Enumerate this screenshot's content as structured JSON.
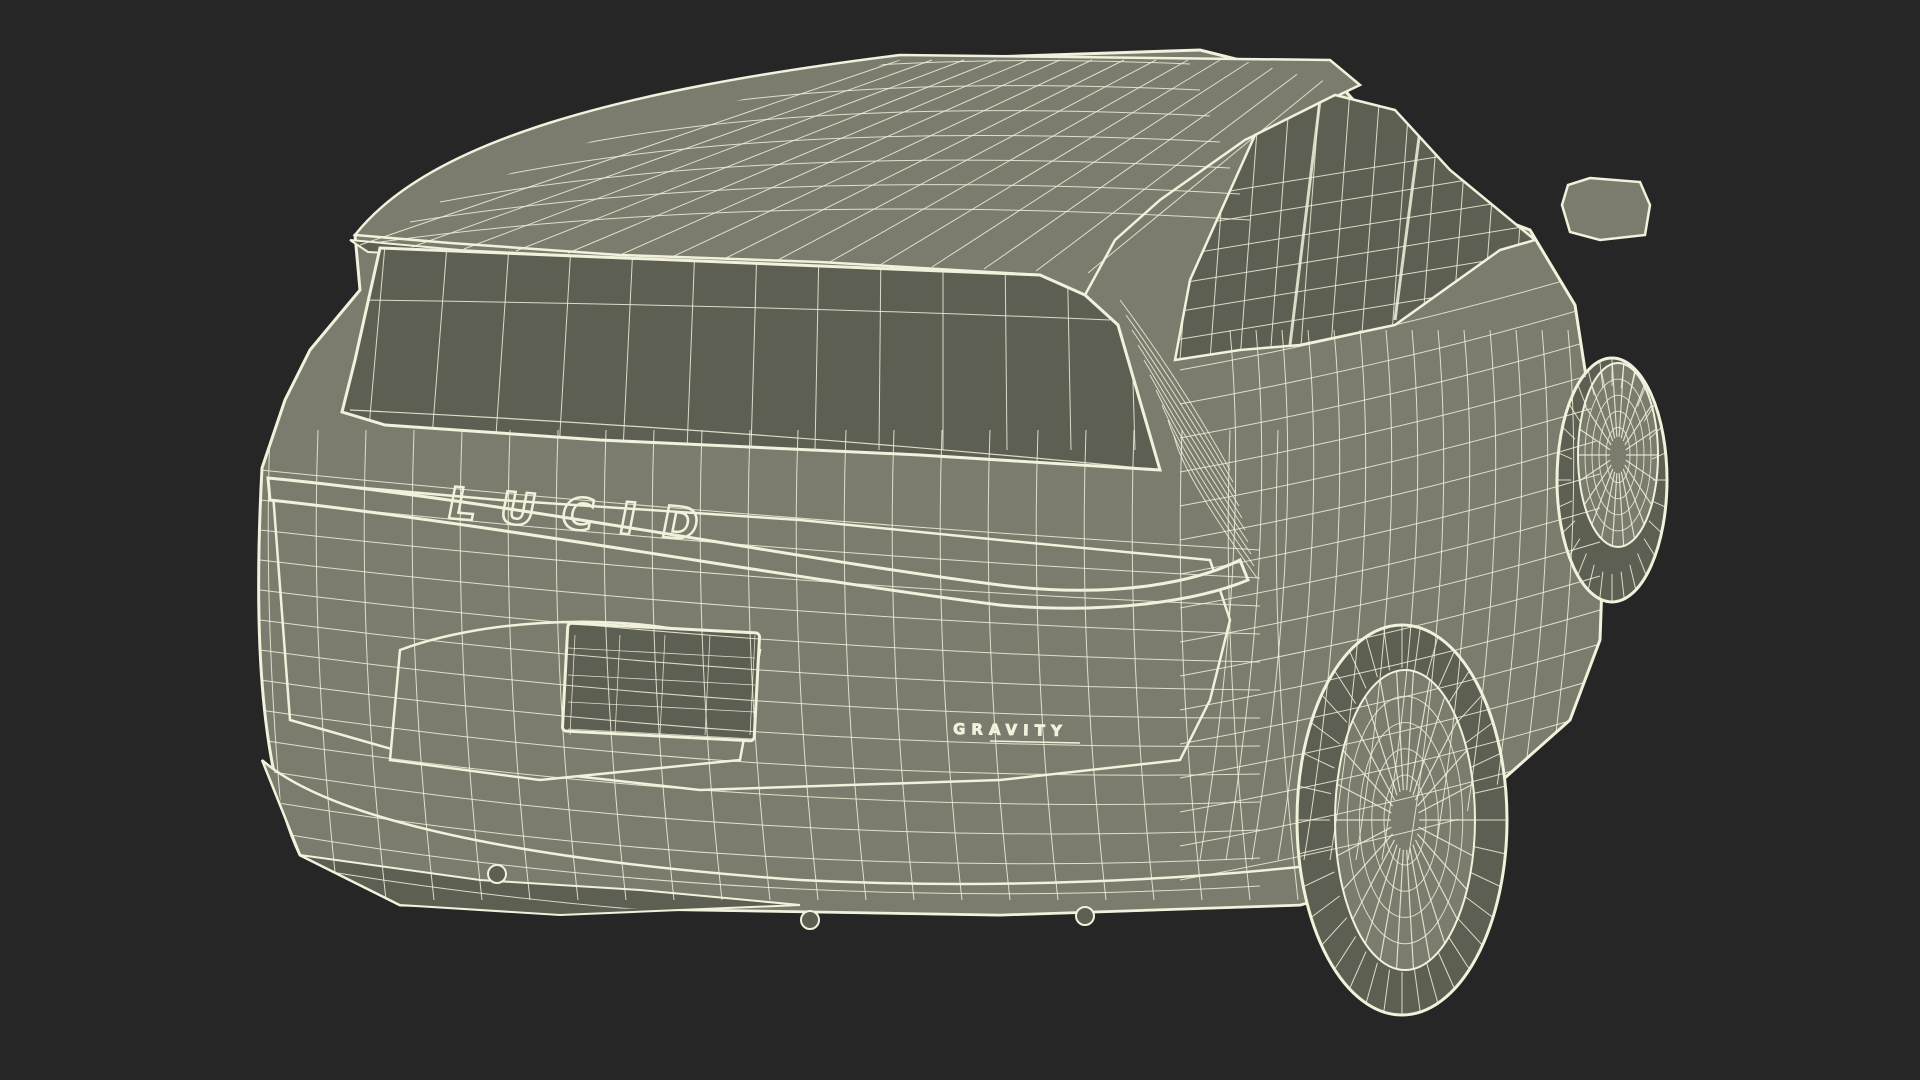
{
  "scene": {
    "background_color": "#262626",
    "surface_color": "#7b7c6d",
    "surface_dark_color": "#5e5f53",
    "wire_color": "#f1f1dc",
    "subject": "wireframe-suv-rear-three-quarter"
  },
  "labels": {
    "rear_emblem": "LUCID",
    "model_badge": "GRAVITY"
  }
}
